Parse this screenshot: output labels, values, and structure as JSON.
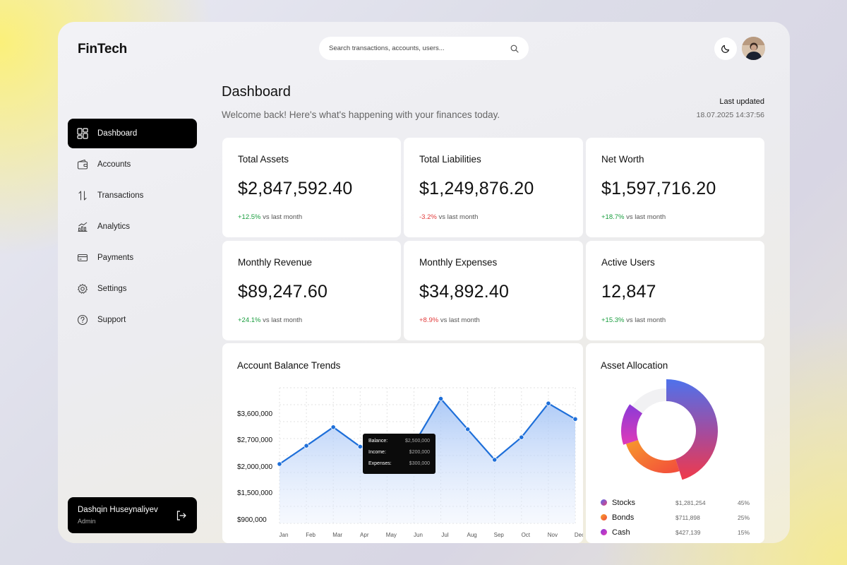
{
  "app": {
    "title": "FinTech"
  },
  "search": {
    "placeholder": "Search transactions, accounts, users..."
  },
  "sidebar": {
    "items": [
      {
        "label": "Dashboard",
        "icon": "dashboard-icon",
        "active": true
      },
      {
        "label": "Accounts",
        "icon": "wallet-icon"
      },
      {
        "label": "Transactions",
        "icon": "transfer-arrows-icon"
      },
      {
        "label": "Analytics",
        "icon": "analytics-icon"
      },
      {
        "label": "Payments",
        "icon": "credit-card-icon"
      },
      {
        "label": "Settings",
        "icon": "gear-icon"
      },
      {
        "label": "Support",
        "icon": "help-icon"
      }
    ]
  },
  "user": {
    "name": "Dashqin Huseynaliyev",
    "role": "Admin"
  },
  "header": {
    "title": "Dashboard",
    "subtitle": "Welcome back! Here's what's happening with your finances today.",
    "last_updated_label": "Last updated",
    "last_updated_value": "18.07.2025 14:37:56"
  },
  "stats": [
    {
      "label": "Total Assets",
      "value": "$2,847,592.40",
      "change": "+12.5%",
      "change_suffix": "vs last month",
      "trend": "pos"
    },
    {
      "label": "Total Liabilities",
      "value": "$1,249,876.20",
      "change": "-3.2%",
      "change_suffix": "vs last month",
      "trend": "neg"
    },
    {
      "label": "Net Worth",
      "value": "$1,597,716.20",
      "change": "+18.7%",
      "change_suffix": "vs last month",
      "trend": "pos"
    },
    {
      "label": "Monthly Revenue",
      "value": "$89,247.60",
      "change": "+24.1%",
      "change_suffix": "vs last month",
      "trend": "pos"
    },
    {
      "label": "Monthly Expenses",
      "value": "$34,892.40",
      "change": "+8.9%",
      "change_suffix": "vs last month",
      "trend": "neg"
    },
    {
      "label": "Active Users",
      "value": "12,847",
      "change": "+15.3%",
      "change_suffix": "vs last month",
      "trend": "pos"
    }
  ],
  "balance_chart": {
    "title": "Account Balance Trends",
    "tooltip": {
      "rows": [
        {
          "label": "Balance:",
          "value": "$2,500,000"
        },
        {
          "label": "Income:",
          "value": "$200,000"
        },
        {
          "label": "Expenses:",
          "value": "$300,000"
        }
      ]
    }
  },
  "allocation": {
    "title": "Asset Allocation",
    "items": [
      {
        "name": "Stocks",
        "amount": "$1,281,254",
        "pct": "45%",
        "color": "#5a6bf0"
      },
      {
        "name": "Bonds",
        "amount": "$711,898",
        "pct": "25%",
        "color": "#f57a2c"
      },
      {
        "name": "Cash",
        "amount": "$427,139",
        "pct": "15%",
        "color": "#b23ad8"
      }
    ]
  },
  "colors": {
    "accent": "#1e6fd9",
    "positive": "#1a9e3f",
    "negative": "#e23b3b"
  },
  "chart_data": [
    {
      "type": "area",
      "title": "Account Balance Trends",
      "categories": [
        "Jan",
        "Feb",
        "Mar",
        "Apr",
        "May",
        "Jun",
        "Jul",
        "Aug",
        "Sep",
        "Oct",
        "Nov",
        "Dec"
      ],
      "y_tick_labels": [
        "$3,600,000",
        "$2,700,000",
        "$2,000,000",
        "$1,500,000",
        "$900,000"
      ],
      "series": [
        {
          "values": [
            1900000,
            2330000,
            2770000,
            2310000,
            2260000,
            2370000,
            3440000,
            2720000,
            2000000,
            2530000,
            3330000,
            2960000
          ]
        }
      ],
      "grid": true
    },
    {
      "type": "pie",
      "title": "Asset Allocation",
      "labels": [
        "Stocks",
        "Bonds",
        "Cash"
      ],
      "values": [
        45,
        25,
        15
      ]
    }
  ]
}
